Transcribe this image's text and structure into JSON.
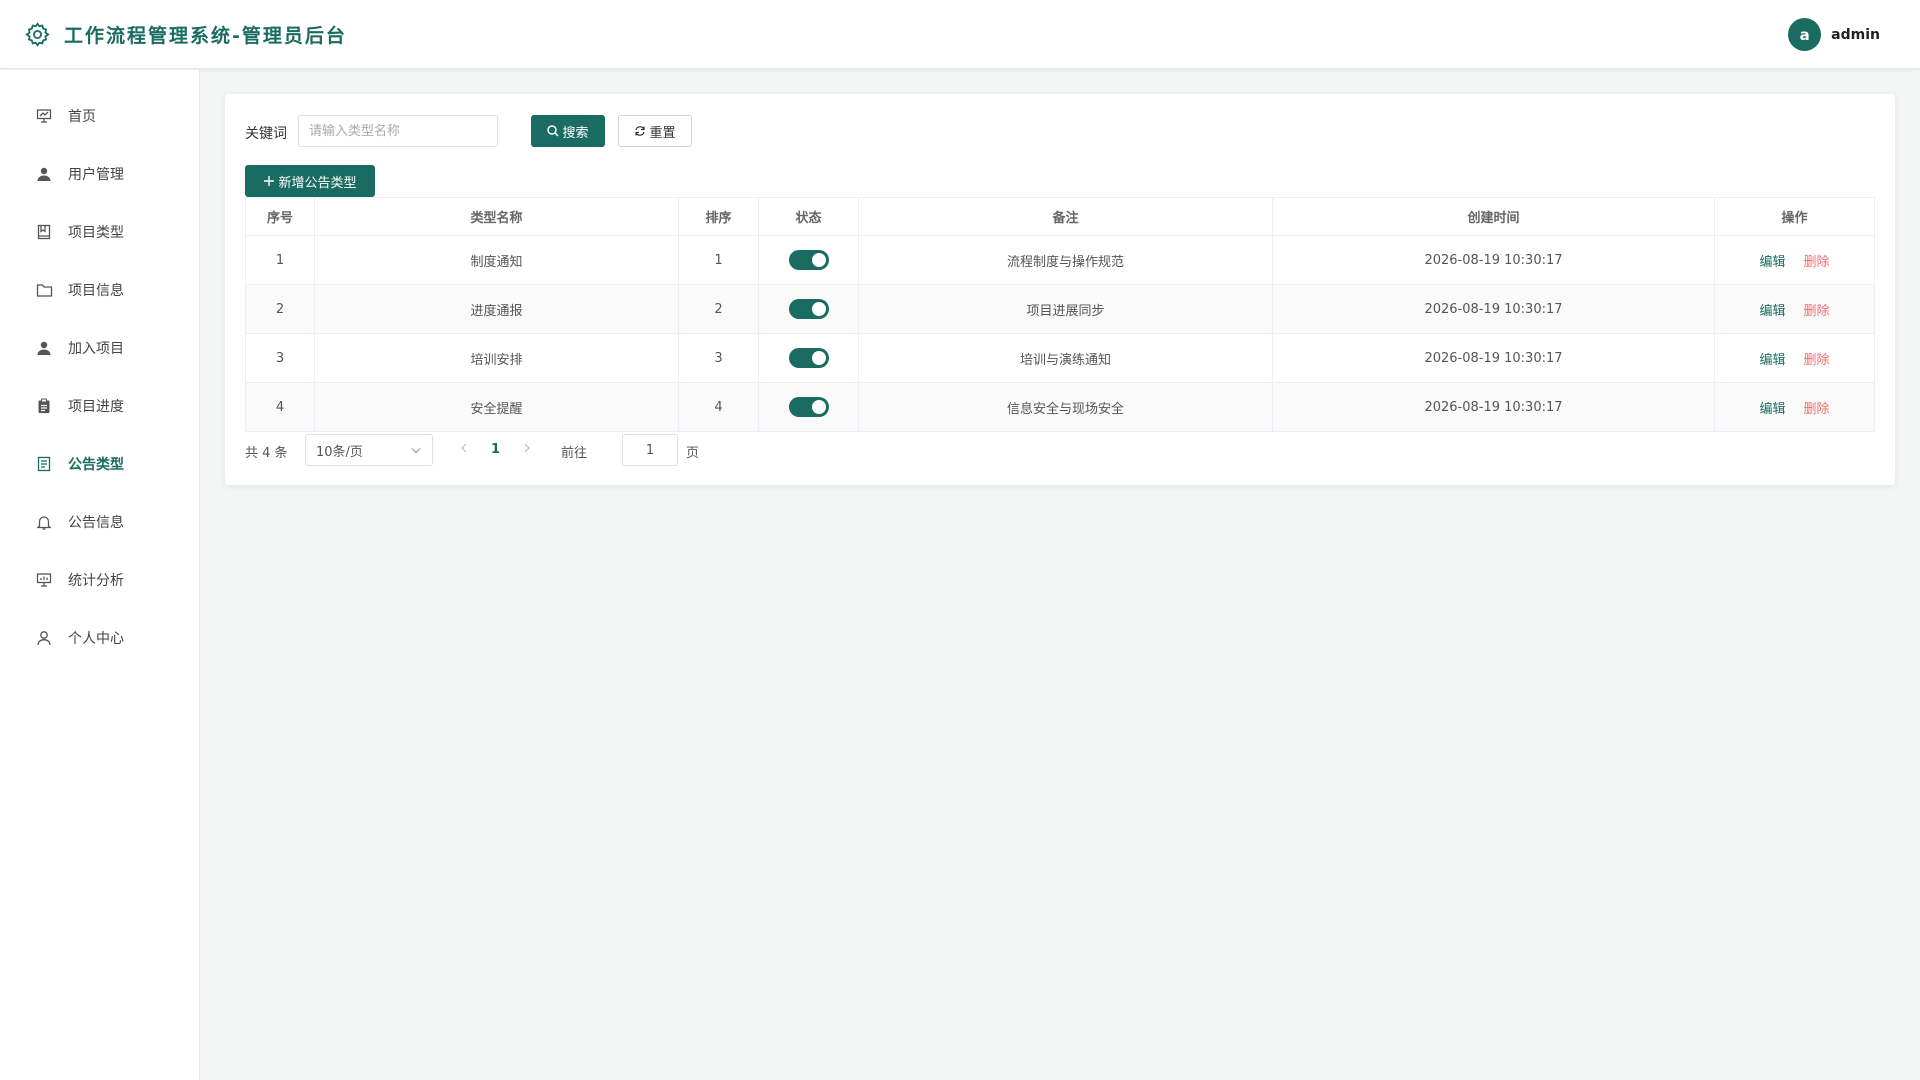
{
  "header": {
    "title": "工作流程管理系统-管理员后台",
    "avatar_letter": "a",
    "username": "admin"
  },
  "sidebar": {
    "items": [
      {
        "label": "首页",
        "icon": "presentation-icon"
      },
      {
        "label": "用户管理",
        "icon": "user-icon"
      },
      {
        "label": "项目类型",
        "icon": "notebook-icon"
      },
      {
        "label": "项目信息",
        "icon": "folder-icon"
      },
      {
        "label": "加入项目",
        "icon": "user-plus-icon"
      },
      {
        "label": "项目进度",
        "icon": "clipboard-icon"
      },
      {
        "label": "公告类型",
        "icon": "document-icon",
        "active": true
      },
      {
        "label": "公告信息",
        "icon": "bell-icon"
      },
      {
        "label": "统计分析",
        "icon": "chart-board-icon"
      },
      {
        "label": "个人中心",
        "icon": "user-outline-icon"
      }
    ]
  },
  "search": {
    "label": "关键词",
    "placeholder": "请输入类型名称",
    "search_button": "搜索",
    "reset_button": "重置",
    "add_button": "新增公告类型"
  },
  "table": {
    "headers": [
      "序号",
      "类型名称",
      "排序",
      "状态",
      "备注",
      "创建时间",
      "操作"
    ],
    "rows": [
      {
        "index": "1",
        "name": "制度通知",
        "sort": "1",
        "status": true,
        "remark": "流程制度与操作规范",
        "created": "2026-08-19 10:30:17"
      },
      {
        "index": "2",
        "name": "进度通报",
        "sort": "2",
        "status": true,
        "remark": "项目进展同步",
        "created": "2026-08-19 10:30:17"
      },
      {
        "index": "3",
        "name": "培训安排",
        "sort": "3",
        "status": true,
        "remark": "培训与演练通知",
        "created": "2026-08-19 10:30:17"
      },
      {
        "index": "4",
        "name": "安全提醒",
        "sort": "4",
        "status": true,
        "remark": "信息安全与现场安全",
        "created": "2026-08-19 10:30:17"
      }
    ],
    "edit_label": "编辑",
    "delete_label": "删除"
  },
  "pagination": {
    "total": "共 4 条",
    "page_size": "10条/页",
    "current_page": "1",
    "goto_label": "前往",
    "goto_value": "1",
    "page_suffix": "页"
  },
  "colors": {
    "primary": "#1a6b61",
    "danger": "#f56c6c"
  }
}
